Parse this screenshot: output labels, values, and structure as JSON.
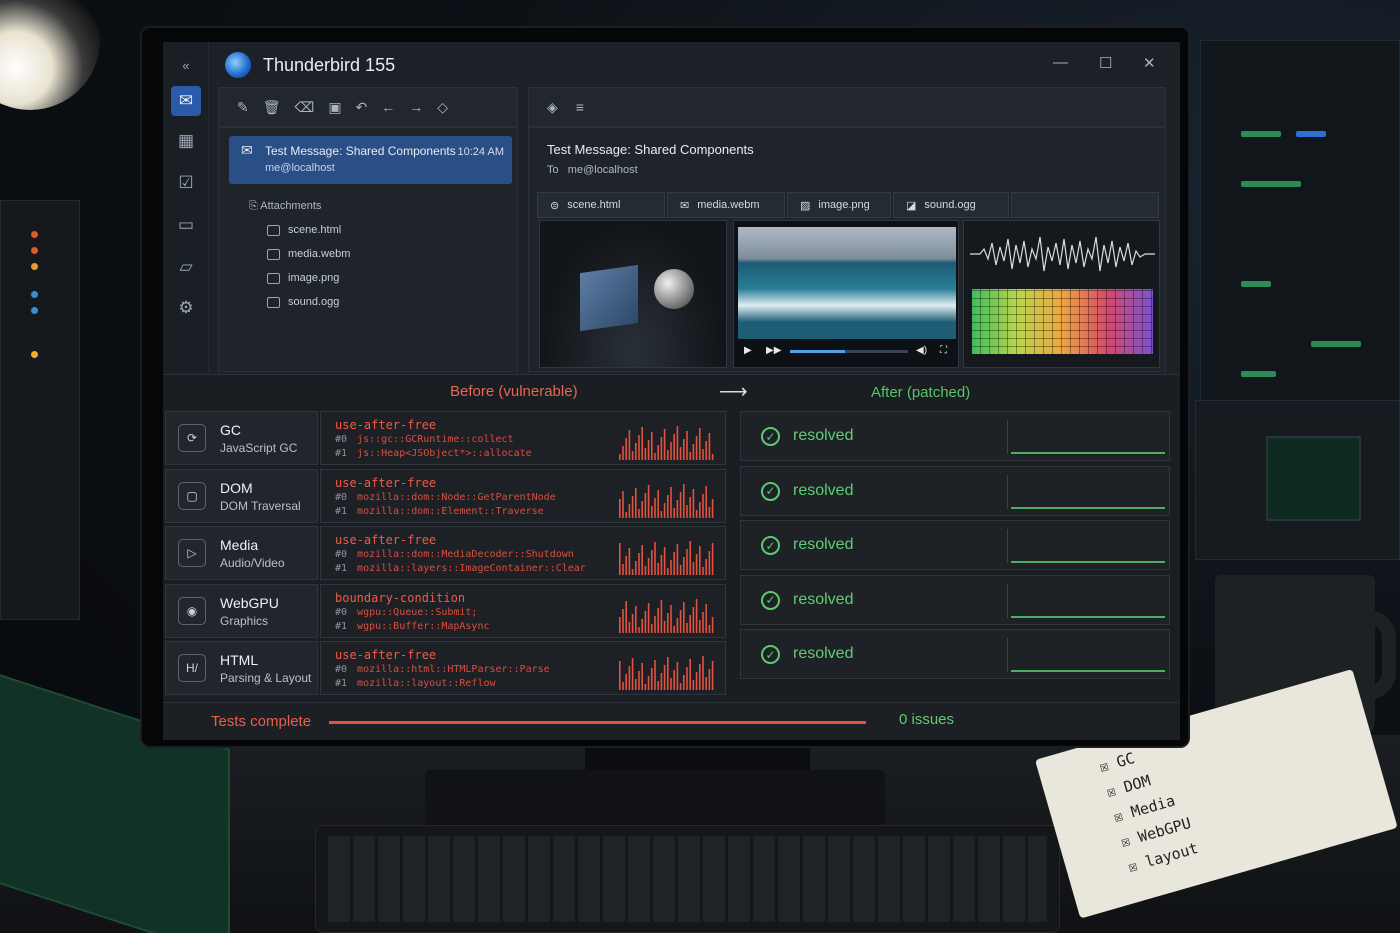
{
  "window": {
    "title": "Thunderbird 155"
  },
  "rail": {
    "icons": [
      "mail-icon",
      "calendar-icon",
      "tasks-icon",
      "chat-icon",
      "folder-icon",
      "settings-icon"
    ]
  },
  "message": {
    "subject": "Test Message: Shared Components",
    "from": "me@localhost",
    "time": "10:24 AM",
    "to_label": "To",
    "to": "me@localhost"
  },
  "attachments": {
    "header": "Attachments",
    "items": [
      "scene.html",
      "media.webm",
      "image.png",
      "sound.ogg"
    ]
  },
  "compare": {
    "before_label": "Before (vulnerable)",
    "arrow": "⟶",
    "after_label": "After (patched)",
    "rows": [
      {
        "name": "GC",
        "subtitle": "JavaScript GC",
        "icon": "gc-icon",
        "kind": "use-after-free",
        "f0_num": "#0",
        "f0": "js::gc::GCRuntime::collect",
        "f1_num": "#1",
        "f1": "js::Heap<JSObject*>::allocate",
        "result": "resolved"
      },
      {
        "name": "DOM",
        "subtitle": "DOM Traversal",
        "icon": "dom-icon",
        "kind": "use-after-free",
        "f0_num": "#0",
        "f0": "mozilla::dom::Node::GetParentNode",
        "f1_num": "#1",
        "f1": "mozilla::dom::Element::Traverse",
        "result": "resolved"
      },
      {
        "name": "Media",
        "subtitle": "Audio/Video",
        "icon": "media-icon",
        "kind": "use-after-free",
        "f0_num": "#0",
        "f0": "mozilla::dom::MediaDecoder::Shutdown",
        "f1_num": "#1",
        "f1": "mozilla::layers::ImageContainer::Clear",
        "result": "resolved"
      },
      {
        "name": "WebGPU",
        "subtitle": "Graphics",
        "icon": "webgpu-icon",
        "kind": "boundary-condition",
        "f0_num": "#0",
        "f0": "wgpu::Queue::Submit;",
        "f1_num": "#1",
        "f1": "wgpu::Buffer::MapAsync",
        "result": "resolved"
      },
      {
        "name": "HTML",
        "subtitle": "Parsing & Layout",
        "icon": "html-icon",
        "kind": "use-after-free",
        "f0_num": "#0",
        "f0": "mozilla::html::HTMLParser::Parse",
        "f1_num": "#1",
        "f1": "mozilla::layout::Reflow",
        "result": "resolved"
      }
    ]
  },
  "footer": {
    "status": "Tests complete",
    "issues": "0 issues"
  },
  "notebook": {
    "lines": [
      "GC",
      "DOM",
      "Media",
      "WebGPU",
      "layout"
    ]
  },
  "colors": {
    "before": "#f25a43",
    "after": "#5fcd73",
    "accent": "#2a5aa8"
  }
}
